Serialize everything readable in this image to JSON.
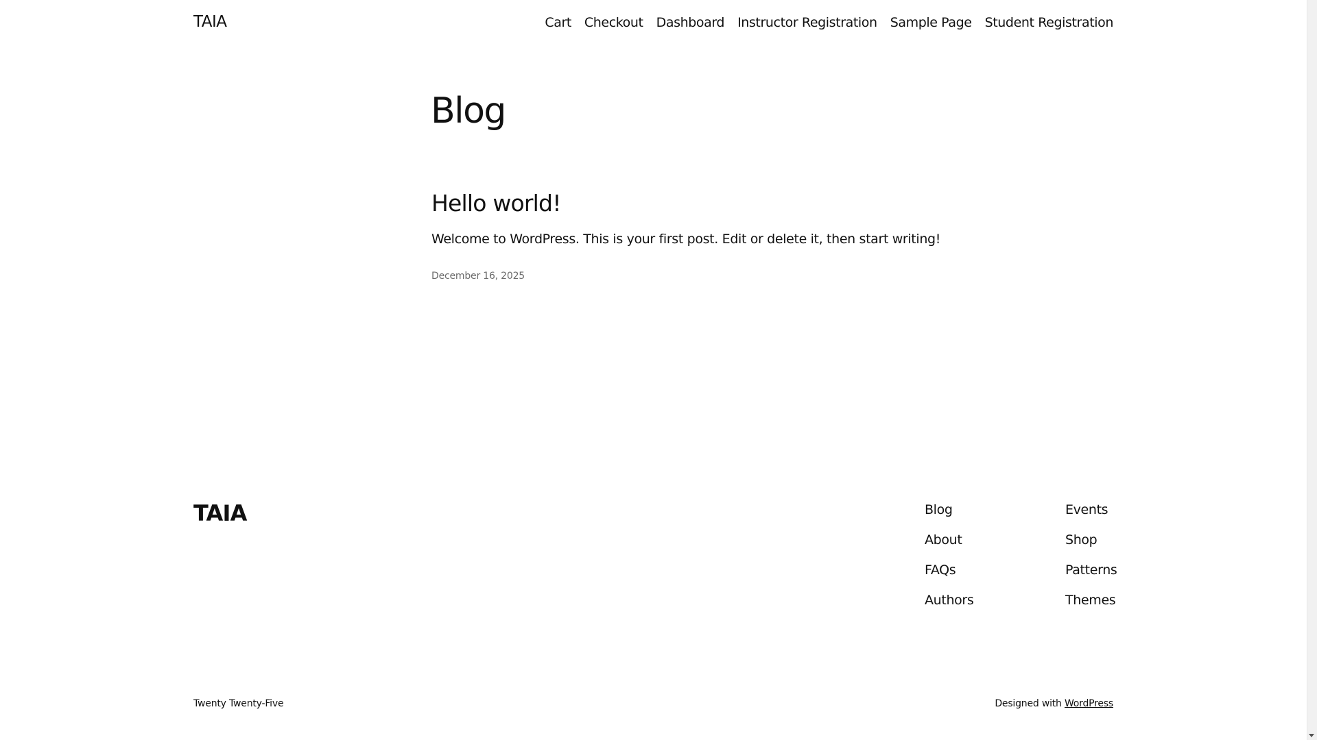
{
  "header": {
    "site_title": "TAIA",
    "nav": [
      {
        "label": "Cart"
      },
      {
        "label": "Checkout"
      },
      {
        "label": "Dashboard"
      },
      {
        "label": "Instructor Registration"
      },
      {
        "label": "Sample Page"
      },
      {
        "label": "Student Registration"
      }
    ]
  },
  "main": {
    "page_title": "Blog",
    "post": {
      "title": "Hello world!",
      "excerpt": "Welcome to WordPress. This is your first post. Edit or delete it, then start writing!",
      "date": "December 16, 2025"
    }
  },
  "footer": {
    "site_title": "TAIA",
    "column_1": [
      {
        "label": "Blog"
      },
      {
        "label": "About"
      },
      {
        "label": "FAQs"
      },
      {
        "label": "Authors"
      }
    ],
    "column_2": [
      {
        "label": "Events"
      },
      {
        "label": "Shop"
      },
      {
        "label": "Patterns"
      },
      {
        "label": "Themes"
      }
    ],
    "theme_credit": "Twenty Twenty-Five",
    "designed_with_prefix": "Designed with ",
    "designed_with_link": "WordPress"
  }
}
